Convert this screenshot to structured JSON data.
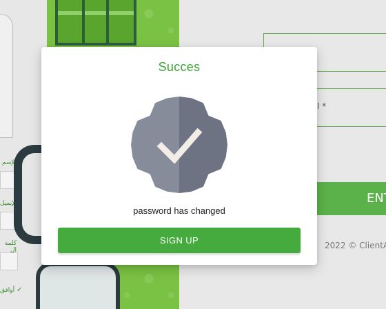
{
  "background": {
    "enter_label": "ENT",
    "copyright": "2022 © ClientA",
    "field_fragment": "ا *",
    "left_labels": [
      "الإسم",
      "الإيميل",
      "كلمة ال",
      "أوافق"
    ],
    "check_mark": "✓"
  },
  "modal": {
    "title": "Succes",
    "icon": "verified-badge-icon",
    "message": "password has changed",
    "button_label": "SIGN UP"
  },
  "colors": {
    "accent": "#46ab3f",
    "title": "#3aa535",
    "badge": "#878c9a",
    "badge_shade": "#6e7384",
    "check": "#f2ede7"
  }
}
